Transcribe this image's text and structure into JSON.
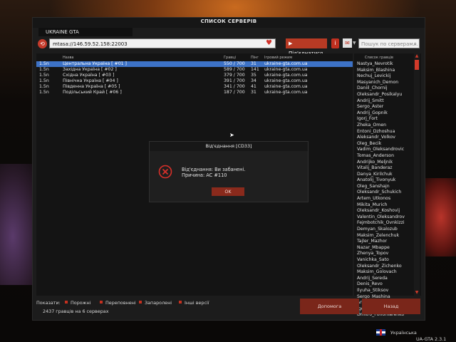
{
  "window": {
    "title": "СПИСОК СЕРВЕРІВ",
    "server_label": "UKRAINE GTA"
  },
  "toolbar": {
    "url": "mtasa://146.59.52.158:22003",
    "connect_label": "▶ Під'єднатися",
    "search_placeholder": "Пошук по серверам..."
  },
  "columns": {
    "name": "Назва",
    "players": "Гравці",
    "ping": "Пінг",
    "gamemode": "Ігровий режим",
    "player_list": "Список гравців"
  },
  "servers": [
    {
      "version": "1.5n",
      "name": "Центральна Україна [ #01 ]",
      "players": "550 / 700",
      "ping": "31",
      "gamemode": "ukraine-gta.com.ua",
      "selected": true
    },
    {
      "version": "1.5n",
      "name": "Західна Україна [ #02 ]",
      "players": "589 / 700",
      "ping": "141",
      "gamemode": "ukraine-gta.com.ua",
      "selected": false
    },
    {
      "version": "1.5n",
      "name": "Східна Україна [ #03 ]",
      "players": "379 / 700",
      "ping": "35",
      "gamemode": "ukraine-gta.com.ua",
      "selected": false
    },
    {
      "version": "1.5n",
      "name": "Північна Україна [ #04 ]",
      "players": "391 / 700",
      "ping": "34",
      "gamemode": "ukraine-gta.com.ua",
      "selected": false
    },
    {
      "version": "1.5n",
      "name": "Південна Україна [ #05 ]",
      "players": "341 / 700",
      "ping": "41",
      "gamemode": "ukraine-gta.com.ua",
      "selected": false
    },
    {
      "version": "1.5n",
      "name": "Подільський Край [ #06 ]",
      "players": "187 / 700",
      "ping": "31",
      "gamemode": "ukraine-gta.com.ua",
      "selected": false
    }
  ],
  "player_list": [
    "Nastya_Nevrotik",
    "Maksim_Blashina",
    "Nechuj_Levickij",
    "Masyanich_Demon",
    "Daniil_Chornij",
    "Oleksandr_Posikalyu",
    "Andrij_Smitt",
    "Sergo_Aster",
    "Andrij_Gopnik",
    "Igorj_Fort",
    "Zhekа_Omen",
    "Entoni_Dzhoshua",
    "Aleksandr_Volkov",
    "Oleg_Becik",
    "Vadim_Oleksandrovic",
    "Tomas_Anderson",
    "Andrijko_Meljnik",
    "Vitalij_Banderaz",
    "Danya_Kirilchuk",
    "Anatolij_Tivonyuk",
    "Oleg_Sanshajn",
    "Oleksandr_Schukich",
    "Artem_Utkonos",
    "Mikita_Murich",
    "Oleksandr_Koshovij",
    "Valentin_Oleksandrov",
    "Fejmbotchik_Ovnkizzi",
    "Demyan_Skalozub",
    "Maksim_Zelenchuk",
    "Tajler_Mazhor",
    "Nazar_Mbappe",
    "Zhenya_Topov",
    "Vanichka_Sato",
    "Oleksandr_Zichenko",
    "Maksim_Golovach",
    "Andrij_Sereda",
    "Denis_Revo",
    "Ilyuha_Stiksov",
    "Sergo_Mashina",
    "Andryuha_Lishko",
    "Igor_Bennington",
    "Dmitro_Ponomarenko"
  ],
  "filters": {
    "show_label": "Показати:",
    "empty": "Порожні",
    "full": "Переповнені",
    "locked": "Запаролені",
    "other_versions": "Інші версії"
  },
  "status": {
    "count": "2437 гравців на 6 серверах"
  },
  "buttons": {
    "help": "Допомога",
    "back": "Назад"
  },
  "dialog": {
    "title": "Від'єднання [CD33]",
    "line1": "Від'єднання: Ви забанені.",
    "line2": "Причина: AC #110",
    "ok": "OK"
  },
  "footer": {
    "language": "Українська",
    "version": "UA-GTA 2.3.1"
  },
  "colors": {
    "accent": "#c43a2a",
    "selection": "#3d72c6",
    "button": "#7a261a"
  }
}
